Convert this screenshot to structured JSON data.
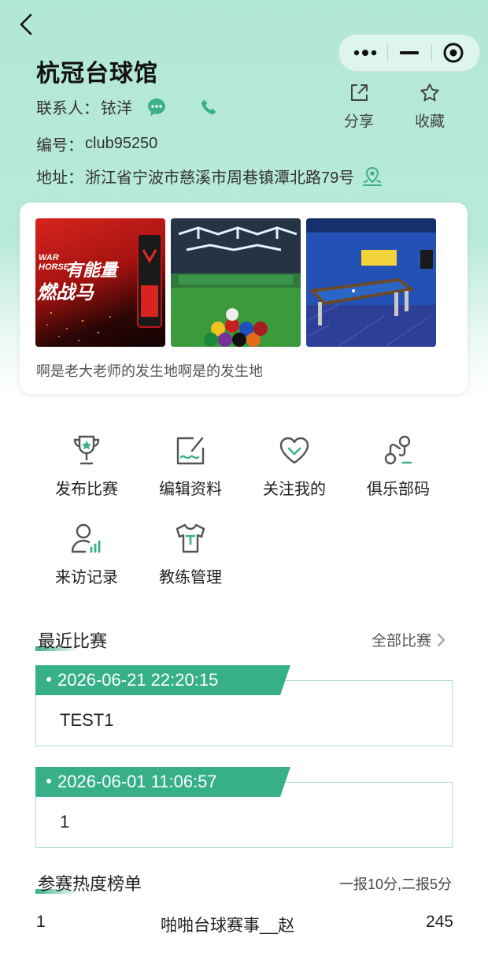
{
  "header": {
    "club_name": "杭冠台球馆",
    "contact_label": "联系人：",
    "contact_name": "铱洋",
    "number_label": "编号：",
    "number_value": "club95250",
    "address_label": "地址：",
    "address_value": "浙江省宁波市慈溪市周巷镇潭北路79号",
    "share_label": "分享",
    "favorite_label": "收藏"
  },
  "gallery": {
    "description": "啊是老大老师的发生地啊是的发生地",
    "ad_text_1": "有能量",
    "ad_text_2": "燃战马",
    "ad_brand": "WAR HORSE"
  },
  "menu": [
    {
      "label": "发布比赛",
      "icon": "trophy-icon"
    },
    {
      "label": "编辑资料",
      "icon": "edit-icon"
    },
    {
      "label": "关注我的",
      "icon": "heart-icon"
    },
    {
      "label": "俱乐部码",
      "icon": "club-code-icon"
    },
    {
      "label": "来访记录",
      "icon": "visitor-icon"
    },
    {
      "label": "教练管理",
      "icon": "tshirt-icon"
    }
  ],
  "recent": {
    "title": "最近比赛",
    "more": "全部比赛",
    "matches": [
      {
        "time": "2026-06-21 22:20:15",
        "name": "TEST1"
      },
      {
        "time": "2026-06-01 11:06:57",
        "name": "1"
      }
    ]
  },
  "ranking": {
    "title": "参赛热度榜单",
    "note": "一报10分,二报5分",
    "rows": [
      {
        "rank": "1",
        "name": "啪啪台球赛事__赵",
        "score": "245"
      }
    ]
  },
  "colors": {
    "accent": "#37b08a",
    "header_bg": "#b3e8d4"
  }
}
